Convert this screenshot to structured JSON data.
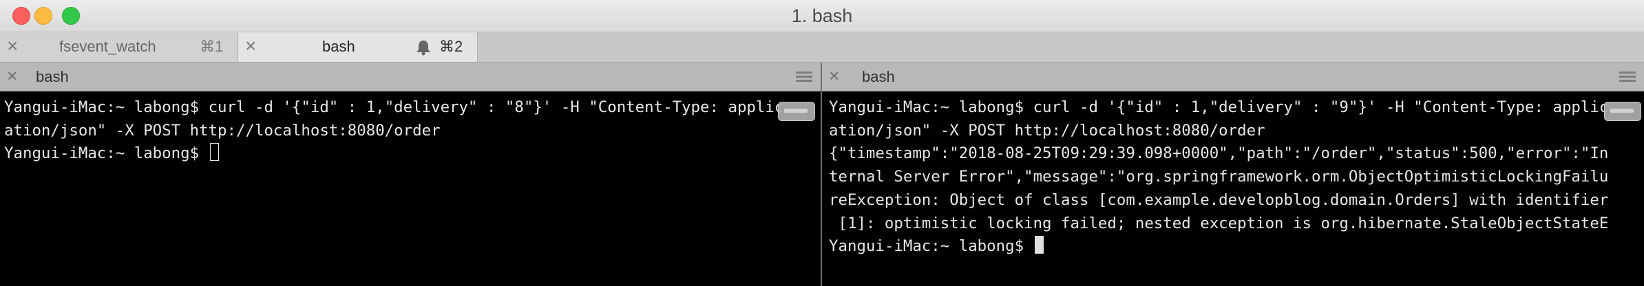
{
  "window": {
    "title": "1. bash"
  },
  "tabs": [
    {
      "close_icon": "×",
      "label": "fsevent_watch",
      "shortcut": "⌘1"
    },
    {
      "close_icon": "×",
      "label": "bash",
      "shortcut": "⌘2",
      "icon": "bell-icon"
    }
  ],
  "panes": {
    "left": {
      "title": "bash",
      "lines": [
        "Yangui-iMac:~ labong$ curl -d '{\"id\" : 1,\"delivery\" : \"8\"}' -H \"Content-Type: applic",
        "ation/json\" -X POST http://localhost:8080/order",
        "Yangui-iMac:~ labong$ "
      ]
    },
    "right": {
      "title": "bash",
      "lines": [
        "Yangui-iMac:~ labong$ curl -d '{\"id\" : 1,\"delivery\" : \"9\"}' -H \"Content-Type: applic",
        "ation/json\" -X POST http://localhost:8080/order",
        "{\"timestamp\":\"2018-08-25T09:29:39.098+0000\",\"path\":\"/order\",\"status\":500,\"error\":\"In",
        "ternal Server Error\",\"message\":\"org.springframework.orm.ObjectOptimisticLockingFailu",
        "reException: Object of class [com.example.developblog.domain.Orders] with identifier",
        " [1]: optimistic locking failed; nested exception is org.hibernate.StaleObjectStateE",
        "Yangui-iMac:~ labong$ "
      ]
    }
  },
  "colors": {
    "terminal_bg": "#000000",
    "terminal_fg": "#e6e6e6",
    "close": "#fc605c",
    "minimize": "#fdbc40",
    "zoom": "#34c84a"
  }
}
